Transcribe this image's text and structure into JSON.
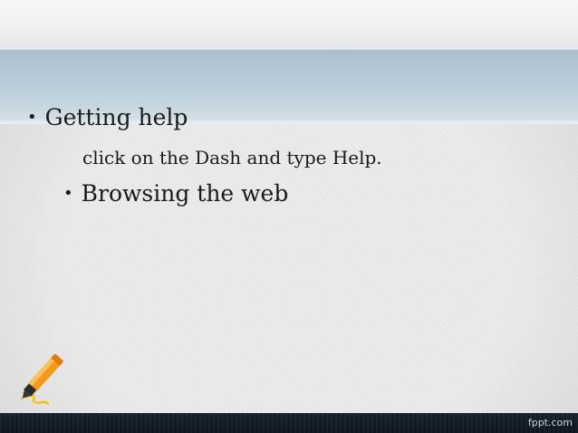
{
  "slide": {
    "bullets": [
      {
        "marker": "•",
        "text": "Getting help"
      },
      {
        "marker": "•",
        "text": "Browsing the web"
      }
    ],
    "sub_text": "click on the Dash and type Help.",
    "watermark": "fppt.com"
  },
  "icons": {
    "decoration": "highlighter-marker-icon"
  },
  "colors": {
    "band_blue": "#b8cbd7",
    "bottom_bar": "#111b24",
    "marker_orange": "#f5a623",
    "text": "#1a1a1a"
  }
}
